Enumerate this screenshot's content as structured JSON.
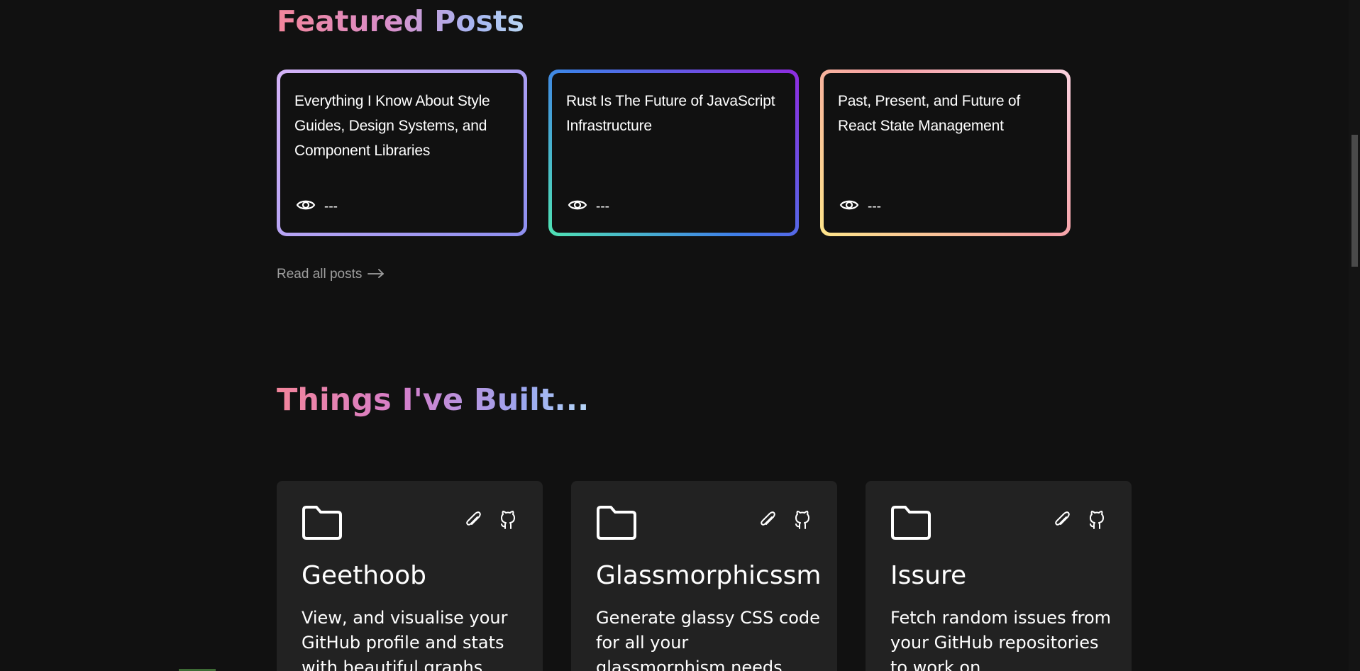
{
  "featured": {
    "title": "Featured Posts",
    "posts": [
      {
        "title": "Everything I Know About Style Guides, Design Systems, and Component Libraries",
        "views": "---"
      },
      {
        "title": "Rust Is The Future of JavaScript Infrastructure",
        "views": "---"
      },
      {
        "title": "Past, Present, and Future of React State Management",
        "views": "---"
      }
    ],
    "read_all_label": "Read all posts"
  },
  "built": {
    "title": "Things I've Built...",
    "projects": [
      {
        "name": "Geethoob",
        "description": "View, and visualise your GitHub profile and stats with beautiful graphs"
      },
      {
        "name": "Glassmorphicssm",
        "description": "Generate glassy CSS code for all your glassmorphism needs"
      },
      {
        "name": "Issure",
        "description": "Fetch random issues from your GitHub repositories to work on"
      }
    ]
  },
  "icons": {
    "views": "eye-icon",
    "read_all": "arrow-right-icon",
    "project_folder": "folder-icon",
    "project_link": "paperclip-icon",
    "project_repo": "github-icon"
  }
}
